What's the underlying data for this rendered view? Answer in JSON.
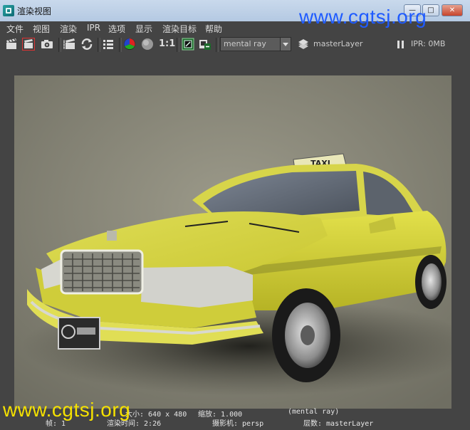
{
  "window": {
    "title": "渲染视图"
  },
  "menus": [
    "文件",
    "视图",
    "渲染",
    "IPR",
    "选项",
    "显示",
    "渲染目标",
    "帮助"
  ],
  "toolbar": {
    "ratio": "1:1",
    "renderer": "mental ray",
    "layer": "masterLayer",
    "ipr_memory": "IPR: 0MB",
    "taxi_sign": "TAXI"
  },
  "status": {
    "line1_size": "大小: 640 x 480",
    "line1_zoom": "缩放: 1.000",
    "line1_renderer": "(mental ray)",
    "line2_frame": "帧: 1",
    "line2_time": "渲染时间: 2:26",
    "line2_camera": "摄影机: persp",
    "line2_layer": "层数: masterLayer"
  },
  "watermarks": {
    "top": "www.cgtsj.org",
    "bottom": "www.cgtsj.org"
  },
  "colors": {
    "watermark_top": "#1f5bff",
    "watermark_bottom": "#f5e100",
    "taxi_yellow": "#d6d42f"
  }
}
